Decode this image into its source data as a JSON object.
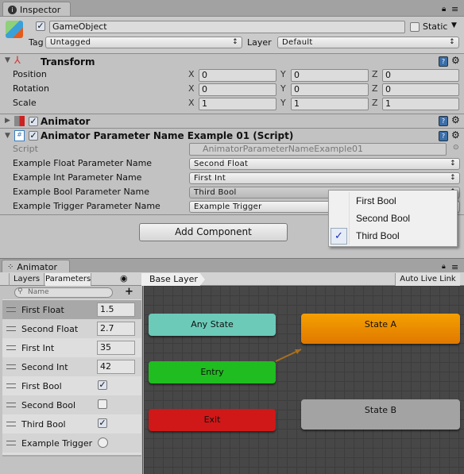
{
  "inspector": {
    "tab": "Inspector",
    "object_name": "GameObject",
    "active": true,
    "static_label": "Static",
    "tag_label": "Tag",
    "tag_value": "Untagged",
    "layer_label": "Layer",
    "layer_value": "Default"
  },
  "transform": {
    "title": "Transform",
    "rows": [
      {
        "label": "Position",
        "x": "0",
        "y": "0",
        "z": "0"
      },
      {
        "label": "Rotation",
        "x": "0",
        "y": "0",
        "z": "0"
      },
      {
        "label": "Scale",
        "x": "1",
        "y": "1",
        "z": "1"
      }
    ],
    "axis_x": "X",
    "axis_y": "Y",
    "axis_z": "Z"
  },
  "animator_component": {
    "title": "Animator",
    "enabled": true
  },
  "script_component": {
    "title": "Animator Parameter Name Example 01 (Script)",
    "enabled": true,
    "script_label": "Script",
    "script_value": "AnimatorParameterNameExample01",
    "fields": [
      {
        "label": "Example Float Parameter Name",
        "value": "Second Float"
      },
      {
        "label": "Example Int Parameter Name",
        "value": "First Int"
      },
      {
        "label": "Example Bool Parameter Name",
        "value": "Third Bool"
      },
      {
        "label": "Example Trigger Parameter Name",
        "value": "Example Trigger"
      }
    ]
  },
  "add_component": "Add Component",
  "popup": {
    "options": [
      {
        "label": "First Bool",
        "checked": false
      },
      {
        "label": "Second Bool",
        "checked": false
      },
      {
        "label": "Third Bool",
        "checked": true
      }
    ],
    "check": "✓"
  },
  "animator": {
    "tab": "Animator",
    "layers_tab": "Layers",
    "parameters_tab": "Parameters",
    "breadcrumb": "Base Layer",
    "auto_live_link": "Auto Live Link",
    "search_placeholder": "Name",
    "parameters": [
      {
        "name": "First Float",
        "type": "float",
        "value": "1.5"
      },
      {
        "name": "Second Float",
        "type": "float",
        "value": "2.7"
      },
      {
        "name": "First Int",
        "type": "int",
        "value": "35"
      },
      {
        "name": "Second Int",
        "type": "int",
        "value": "42"
      },
      {
        "name": "First Bool",
        "type": "bool",
        "value": true
      },
      {
        "name": "Second Bool",
        "type": "bool",
        "value": false
      },
      {
        "name": "Third Bool",
        "type": "bool",
        "value": true
      },
      {
        "name": "Example Trigger",
        "type": "trigger",
        "value": false
      }
    ],
    "nodes": {
      "any_state": "Any State",
      "entry": "Entry",
      "exit": "Exit",
      "state_a": "State A",
      "state_b": "State B"
    },
    "colors": {
      "any_state": "#6ccab9",
      "entry": "#1fbd1f",
      "exit": "#d01818",
      "state_a": "#f08a00",
      "state_b": "#a3a3a3",
      "graph_bg": "#474747"
    }
  }
}
